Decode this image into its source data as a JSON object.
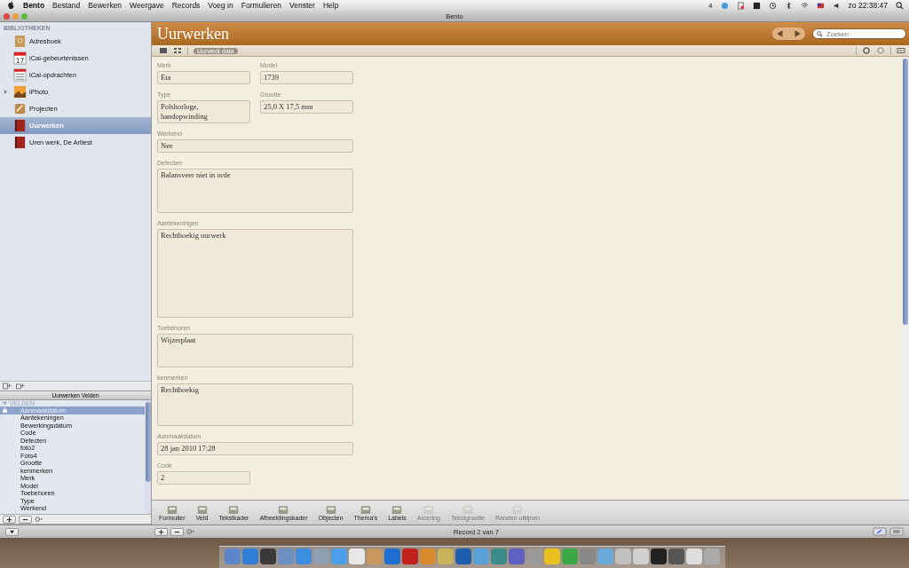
{
  "menubar": {
    "app": "Bento",
    "items": [
      "Bestand",
      "Bewerken",
      "Weergave",
      "Records",
      "Voeg in",
      "Formulieren",
      "Venster",
      "Help"
    ],
    "badge": "4",
    "clock": "zo 22:38:47"
  },
  "window": {
    "title": "Bento"
  },
  "sidebar": {
    "heading": "BIBLIOTHEKEN",
    "items": [
      {
        "label": "Adresboek",
        "kind": "book",
        "selected": false
      },
      {
        "label": "iCal-gebeurtenissen",
        "kind": "calendar",
        "selected": false,
        "calendar_day": "17"
      },
      {
        "label": "iCal-opdrachten",
        "kind": "tasks",
        "selected": false
      },
      {
        "label": "iPhoto",
        "kind": "photo",
        "selected": false,
        "expanded": false
      },
      {
        "label": "Projecten",
        "kind": "project",
        "selected": false
      },
      {
        "label": "Uurwerken",
        "kind": "collection",
        "selected": true
      },
      {
        "label": "Uren werk, De Artiest",
        "kind": "collection",
        "selected": false
      }
    ]
  },
  "fields_panel": {
    "title": "Uurwerken Velden",
    "section": "VELDEN",
    "items": [
      {
        "label": "Aanmaakdatum",
        "selected": true,
        "locked": true
      },
      {
        "label": "Aantekeningen",
        "selected": false,
        "locked": false
      },
      {
        "label": "Bewerkingsdatum",
        "selected": false,
        "locked": false
      },
      {
        "label": "Code",
        "selected": false,
        "locked": false
      },
      {
        "label": "Defecten",
        "selected": false,
        "locked": false
      },
      {
        "label": "foto2",
        "selected": false,
        "locked": false
      },
      {
        "label": "Foto4",
        "selected": false,
        "locked": false
      },
      {
        "label": "Grootte",
        "selected": false,
        "locked": false
      },
      {
        "label": "kenmerken",
        "selected": false,
        "locked": false
      },
      {
        "label": "Merk",
        "selected": false,
        "locked": false
      },
      {
        "label": "Model",
        "selected": false,
        "locked": false
      },
      {
        "label": "Toebehoren",
        "selected": false,
        "locked": false
      },
      {
        "label": "Type",
        "selected": false,
        "locked": false
      },
      {
        "label": "Werkend",
        "selected": false,
        "locked": false
      }
    ]
  },
  "header": {
    "title": "Uurwerken",
    "search": {
      "placeholder": "Zoeken"
    }
  },
  "form_tab": "Uurwerk data",
  "form": [
    {
      "fields": [
        {
          "label": "Merk",
          "value": "Eta",
          "kind": "line"
        },
        {
          "label": "Model",
          "value": "1739",
          "kind": "line"
        }
      ]
    },
    {
      "fields": [
        {
          "label": "Type",
          "value": "Polshorloge, handopwinding",
          "kind": "area"
        },
        {
          "label": "Grootte",
          "value": "25,0 X 17,5 mm",
          "kind": "line"
        }
      ]
    },
    {
      "fields": [
        {
          "label": "Werkend",
          "value": "Nee",
          "kind": "wide"
        }
      ]
    },
    {
      "fields": [
        {
          "label": "Defecten",
          "value": "Balansveer niet in orde",
          "kind": "area"
        }
      ]
    },
    {
      "fields": [
        {
          "label": "Aantekeningen",
          "value": "Rechthoekig uurwerk",
          "kind": "area"
        }
      ]
    },
    {
      "fields": [
        {
          "label": "Toebehoren",
          "value": "Wijzerplaat",
          "kind": "area"
        }
      ]
    },
    {
      "fields": [
        {
          "label": "kenmerken",
          "value": "Rechthoekig",
          "kind": "area"
        }
      ]
    },
    {
      "fields": [
        {
          "label": "Aanmaakdatum",
          "value": "28 jan 2010 17:28",
          "kind": "wide"
        }
      ]
    },
    {
      "fields": [
        {
          "label": "Code",
          "value": "2",
          "kind": "line"
        }
      ]
    }
  ],
  "toolbar": [
    {
      "label": "Formulier",
      "disabled": false
    },
    {
      "label": "Veld",
      "disabled": false
    },
    {
      "label": "Tekstkader",
      "disabled": false
    },
    {
      "label": "Afbeeldingskader",
      "disabled": false
    },
    {
      "label": "Objecten",
      "disabled": false
    },
    {
      "label": "Thema's",
      "disabled": false
    },
    {
      "label": "Labels",
      "disabled": false
    },
    {
      "label": "Arcering",
      "disabled": true
    },
    {
      "label": "Tekstgrootte",
      "disabled": true
    },
    {
      "label": "Randen uitlijnen",
      "disabled": true
    }
  ],
  "status_bar": {
    "text": "Record 2 van 7"
  }
}
